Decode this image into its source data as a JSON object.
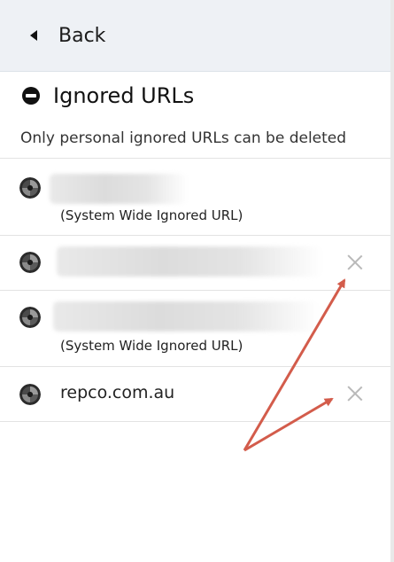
{
  "back": {
    "label": "Back"
  },
  "header": {
    "title": "Ignored URLs"
  },
  "info": {
    "text": "Only personal ignored URLs can be deleted"
  },
  "urls": [
    {
      "url": "",
      "note": "(System Wide Ignored URL)",
      "deletable": false,
      "blurred": true
    },
    {
      "url": "",
      "note": "",
      "deletable": true,
      "blurred": true
    },
    {
      "url": "",
      "note": "(System Wide Ignored URL)",
      "deletable": false,
      "blurred": true
    },
    {
      "url": "repco.com.au",
      "note": "",
      "deletable": true,
      "blurred": false
    }
  ],
  "icons": {
    "back": "caret-left-icon",
    "title": "no-entry-icon",
    "site": "site-favicon-icon",
    "delete": "close-icon"
  },
  "annotation": {
    "color": "#d35c4b"
  }
}
